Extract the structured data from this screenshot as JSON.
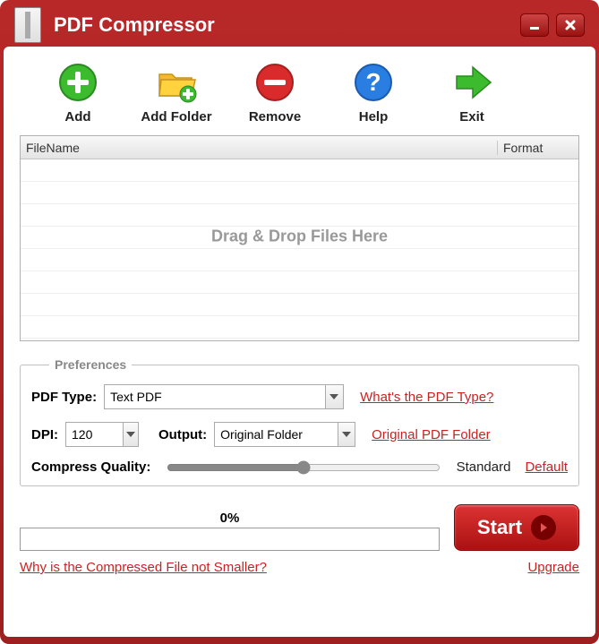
{
  "title": "PDF Compressor",
  "toolbar": {
    "add": "Add",
    "addfolder": "Add Folder",
    "remove": "Remove",
    "help": "Help",
    "exit": "Exit"
  },
  "list": {
    "col_filename": "FileName",
    "col_format": "Format",
    "dropmsg": "Drag & Drop Files Here"
  },
  "prefs": {
    "legend": "Preferences",
    "pdftype_lbl": "PDF Type:",
    "pdftype_val": "Text PDF",
    "pdftype_link": "What's the PDF Type?",
    "dpi_lbl": "DPI:",
    "dpi_val": "120",
    "output_lbl": "Output:",
    "output_val": "Original Folder",
    "output_link": "Original PDF Folder",
    "quality_lbl": "Compress Quality:",
    "quality_txt": "Standard",
    "quality_link": "Default"
  },
  "progress": {
    "text": "0%"
  },
  "start": "Start",
  "footer": {
    "why": "Why is the Compressed File not Smaller?",
    "upgrade": "Upgrade"
  }
}
